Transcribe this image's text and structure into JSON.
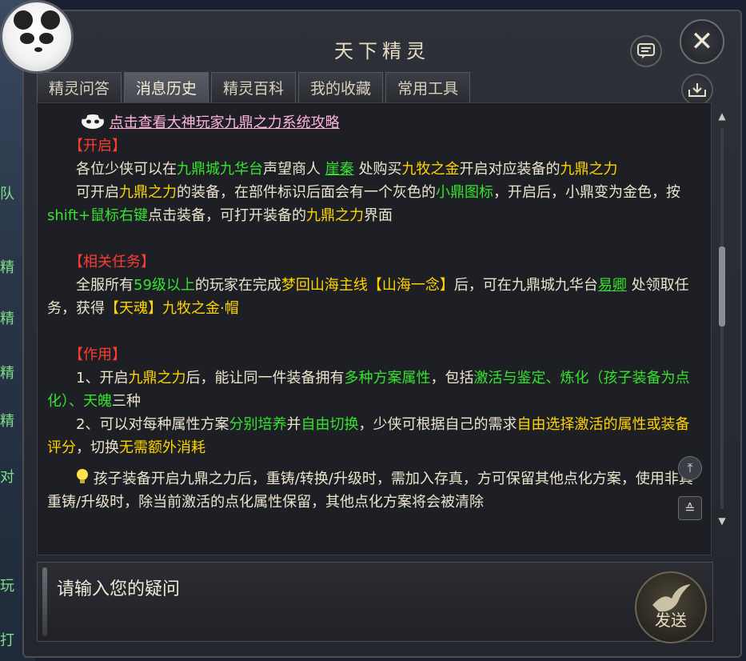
{
  "window": {
    "title": "天下精灵"
  },
  "tabs": [
    {
      "label": "精灵问答",
      "active": false
    },
    {
      "label": "消息历史",
      "active": true
    },
    {
      "label": "精灵百科",
      "active": false
    },
    {
      "label": "我的收藏",
      "active": false
    },
    {
      "label": "常用工具",
      "active": false
    }
  ],
  "message": {
    "top_link": "点击查看大神玩家九鼎之力系统攻略",
    "sec1": {
      "header": "【开启】",
      "p1": [
        "各位少侠可以在",
        "九鼎城九华台",
        "声望商人 ",
        "崖秦",
        " 处购买",
        "九牧之金",
        "开启对应装备的",
        "九鼎之力"
      ],
      "p2": [
        "可开启",
        "九鼎之力",
        "的装备，在部件标识后面会有一个灰色的",
        "小鼎图标",
        "，开启后，小鼎变为金色，按",
        "shift+鼠标右键",
        "点击装备，可打开装备的",
        "九鼎之力",
        "界面"
      ]
    },
    "sec2": {
      "header": "【相关任务】",
      "p1": [
        "全服所有",
        "59级以上",
        "的玩家在完成",
        "梦回山海主线【山海一念】",
        "后，可在九鼎城九华台",
        "易卿",
        " 处领取任务，获得",
        "【天魂】九牧之金·帽"
      ]
    },
    "sec3": {
      "header": "【作用】",
      "p1": [
        "1、开启",
        "九鼎之力",
        "后，能让同一件装备拥有",
        "多种方案属性",
        "，包括",
        "激活与鉴定、炼化（孩子装备为点化）、天魄",
        "三种"
      ],
      "p2": [
        "2、可以对每种属性方案",
        "分别培养",
        "并",
        "自由切换",
        "，少侠可根据自己的需求",
        "自由选择激活的属性或装备评分",
        "，切换",
        "无需额外消耗"
      ]
    },
    "tip": "孩子装备开启九鼎之力后，重铸/转换/升级时，需加入存真，方可保留其他点化方案，使用非真重铸/升级时，除当前激活的点化属性保留，其他点化方案将会被清除"
  },
  "input": {
    "placeholder": "请输入您的疑问",
    "value": ""
  },
  "send_button": {
    "label": "发送"
  },
  "backdrop_tags": [
    "队",
    "精",
    "精",
    "精",
    "精",
    "对",
    "玩",
    "打"
  ],
  "icons": {
    "close": "close-icon",
    "chat": "chat-bubble-icon",
    "save": "save-tray-icon",
    "scroll_top": "scroll-to-top-icon",
    "collapse": "collapse-icon",
    "tip": "lightbulb-icon",
    "link": "panda-mini-icon"
  },
  "colors": {
    "highlight_yellow": "#ffd400",
    "highlight_green": "#35e32e",
    "header_red": "#ff3b2f",
    "link_pink": "#ffb3d6",
    "body_text": "#ece4cc"
  }
}
